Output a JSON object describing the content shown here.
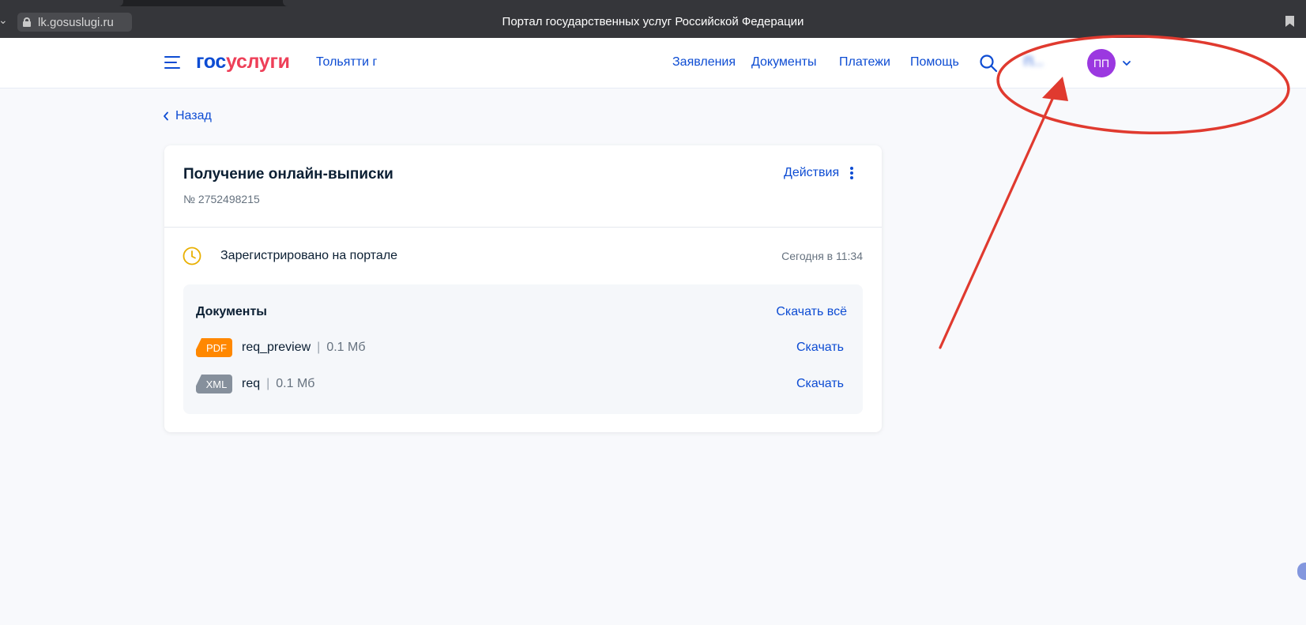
{
  "browser": {
    "url": "lk.gosuslugi.ru",
    "title": "Портал государственных услуг Российской Федерации"
  },
  "header": {
    "logo_part1": "гос",
    "logo_part2": "услуги",
    "city": "Тольятти г",
    "nav": [
      "Заявления",
      "Документы",
      "Платежи",
      "Помощь"
    ],
    "username": "П...",
    "avatar_initials": "ПП"
  },
  "back_label": "Назад",
  "card": {
    "title": "Получение онлайн-выписки",
    "number": "№ 2752498215",
    "actions_label": "Действия",
    "status_text": "Зарегистрировано на портале",
    "status_time": "Сегодня в 11:34",
    "documents": {
      "title": "Документы",
      "download_all": "Скачать всё",
      "files": [
        {
          "type": "PDF",
          "name": "req_preview",
          "size": "0.1 Мб",
          "download": "Скачать"
        },
        {
          "type": "XML",
          "name": "req",
          "size": "0.1 Мб",
          "download": "Скачать"
        }
      ]
    }
  },
  "colors": {
    "brand_blue": "#0d4cd3",
    "brand_red": "#ee3f58",
    "avatar": "#9b38e0",
    "pdf_badge": "#ff8800",
    "xml_badge": "#86909c",
    "annotation_red": "#e03a2f",
    "status_clock": "#e9b000"
  }
}
